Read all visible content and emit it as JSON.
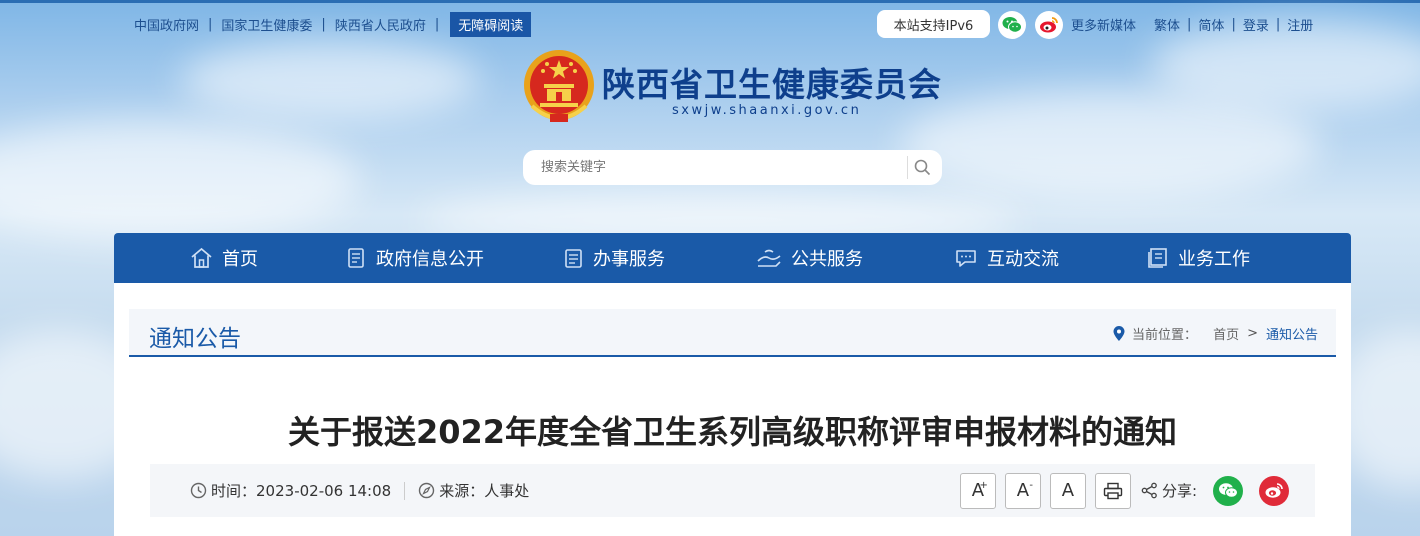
{
  "top_links": {
    "items": [
      "中国政府网",
      "国家卫生健康委",
      "陕西省人民政府"
    ],
    "accessibility": "无障碍阅读"
  },
  "header_right": {
    "ipv6": "本站支持IPv6",
    "more_media": "更多新媒体",
    "traditional": "繁体",
    "simplified": "简体",
    "login": "登录",
    "register": "注册"
  },
  "site": {
    "name": "陕西省卫生健康委员会",
    "domain": "sxwjw.shaanxi.gov.cn"
  },
  "search": {
    "placeholder": "搜索关键字"
  },
  "nav": {
    "items": [
      "首页",
      "政府信息公开",
      "办事服务",
      "公共服务",
      "互动交流",
      "业务工作"
    ]
  },
  "section": {
    "title": "通知公告",
    "breadcrumb_label": "当前位置：",
    "breadcrumb_home": "首页",
    "breadcrumb_sep": ">",
    "breadcrumb_current": "通知公告"
  },
  "article": {
    "title": "关于报送2022年度全省卫生系列高级职称评审申报材料的通知",
    "time_label": "时间：",
    "time": "2023-02-06 14:08",
    "source_label": "来源：",
    "source": "人事处",
    "share_label": "分享:",
    "font_large": "A",
    "font_small": "A",
    "font_reset": "A"
  },
  "colors": {
    "primary": "#1a5aa8",
    "wechat": "#20b04b",
    "weibo": "#e02b39"
  }
}
